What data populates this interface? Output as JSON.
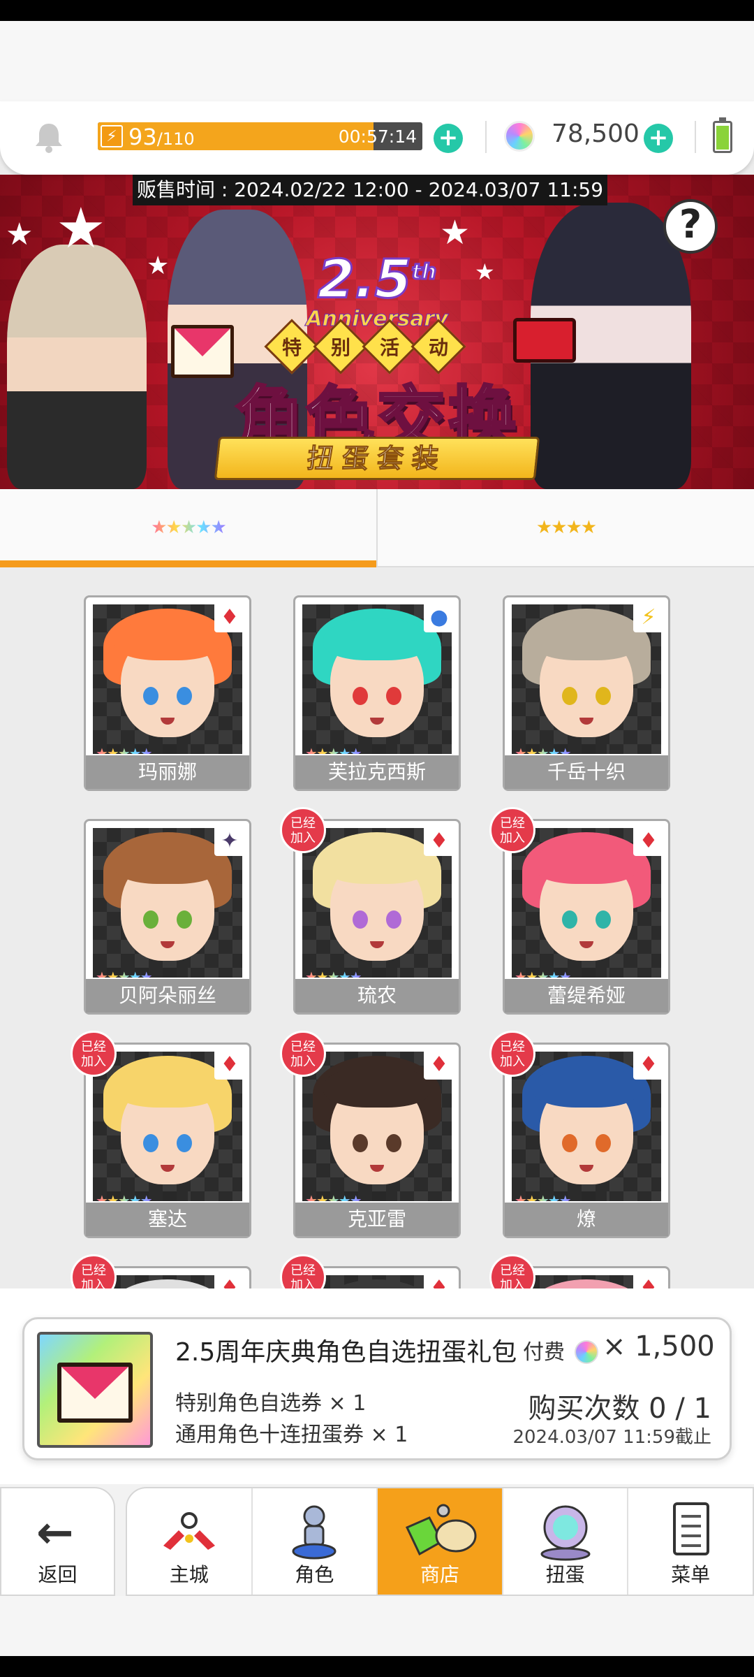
{
  "header": {
    "stamina_current": "93",
    "stamina_max": "/110",
    "stamina_fraction": 0.85,
    "stamina_timer": "00:57:14",
    "gems": "78,500"
  },
  "banner": {
    "sale_time": "贩售时间 : 2024.02/22 12:00 - 2024.03/07 11:59",
    "anniversary_number": "2.5",
    "anniversary_suffix": "th",
    "anniversary_word": "Anniversary",
    "event_tags": [
      "特",
      "别",
      "活",
      "动"
    ],
    "title": "角色交换",
    "subtitle": "扭蛋套装",
    "help": "?"
  },
  "tabs": [
    {
      "label": "★★★★★",
      "active": true
    },
    {
      "label": "★★★★",
      "active": false
    }
  ],
  "characters": [
    {
      "name": "玛丽娜",
      "stars": "★★★★★",
      "element": "♦",
      "element_color": "#e0303a",
      "joined": false,
      "hair": "#ff7a3c",
      "eye": "#3a8ee0"
    },
    {
      "name": "芙拉克西斯",
      "stars": "★★★★★",
      "element": "●",
      "element_color": "#3a7be0",
      "joined": false,
      "hair": "#2fd6c2",
      "eye": "#e03a3a"
    },
    {
      "name": "千岳十织",
      "stars": "★★★★★",
      "element": "⚡",
      "element_color": "#f2c21c",
      "joined": false,
      "hair": "#b8ad9c",
      "eye": "#e0b61c"
    },
    {
      "name": "贝阿朵丽丝",
      "stars": "★★★★★",
      "element": "✦",
      "element_color": "#4a3a6a",
      "joined": false,
      "hair": "#a8663a",
      "eye": "#6ab03a"
    },
    {
      "name": "琉农",
      "stars": "★★★★★",
      "element": "♦",
      "element_color": "#e0303a",
      "joined": true,
      "hair": "#f2e0a0",
      "eye": "#b06ad6"
    },
    {
      "name": "蕾缇希娅",
      "stars": "★★★★★",
      "element": "♦",
      "element_color": "#e0303a",
      "joined": true,
      "hair": "#f25a7a",
      "eye": "#2fb4a8"
    },
    {
      "name": "塞达",
      "stars": "★★★★★",
      "element": "♦",
      "element_color": "#e0303a",
      "joined": true,
      "hair": "#f7d46a",
      "eye": "#3a8ee0"
    },
    {
      "name": "克亚雷",
      "stars": "★★★★★",
      "element": "♦",
      "element_color": "#e0303a",
      "joined": true,
      "hair": "#3a2a24",
      "eye": "#5a3a2a"
    },
    {
      "name": "燎",
      "stars": "★★★★★",
      "element": "♦",
      "element_color": "#e0303a",
      "joined": true,
      "hair": "#2a5aa8",
      "eye": "#e06a2a"
    },
    {
      "name": "",
      "stars": "",
      "element": "♦",
      "element_color": "#e0303a",
      "joined": true,
      "hair": "#e0e0e0",
      "eye": "#888888"
    },
    {
      "name": "",
      "stars": "",
      "element": "♦",
      "element_color": "#e0303a",
      "joined": true,
      "hair": "#3a3a3a",
      "eye": "#888888"
    },
    {
      "name": "",
      "stars": "",
      "element": "♦",
      "element_color": "#e0303a",
      "joined": true,
      "hair": "#f2a0b0",
      "eye": "#888888"
    }
  ],
  "joined_label_line1": "已经",
  "joined_label_line2": "加入",
  "package": {
    "title": "2.5周年庆典角色自选扭蛋礼包",
    "price_label": "付费",
    "price": "× 1,500",
    "item1": "特别角色自选券 × 1",
    "item2": "通用角色十连扭蛋券 × 1",
    "purchase_count": "购买次数 0 / 1",
    "deadline": "2024.03/07 11:59截止"
  },
  "nav": {
    "back": "返回",
    "items": [
      {
        "label": "主城",
        "icon": "castle-icon",
        "active": false
      },
      {
        "label": "角色",
        "icon": "character-icon",
        "active": false
      },
      {
        "label": "商店",
        "icon": "shop-icon",
        "active": true
      },
      {
        "label": "扭蛋",
        "icon": "gacha-icon",
        "active": false
      },
      {
        "label": "菜单",
        "icon": "menu-icon",
        "active": false
      }
    ]
  },
  "colors": {
    "accent": "#f59b1c",
    "teal": "#25c8a8",
    "banner_red": "#b71627"
  }
}
